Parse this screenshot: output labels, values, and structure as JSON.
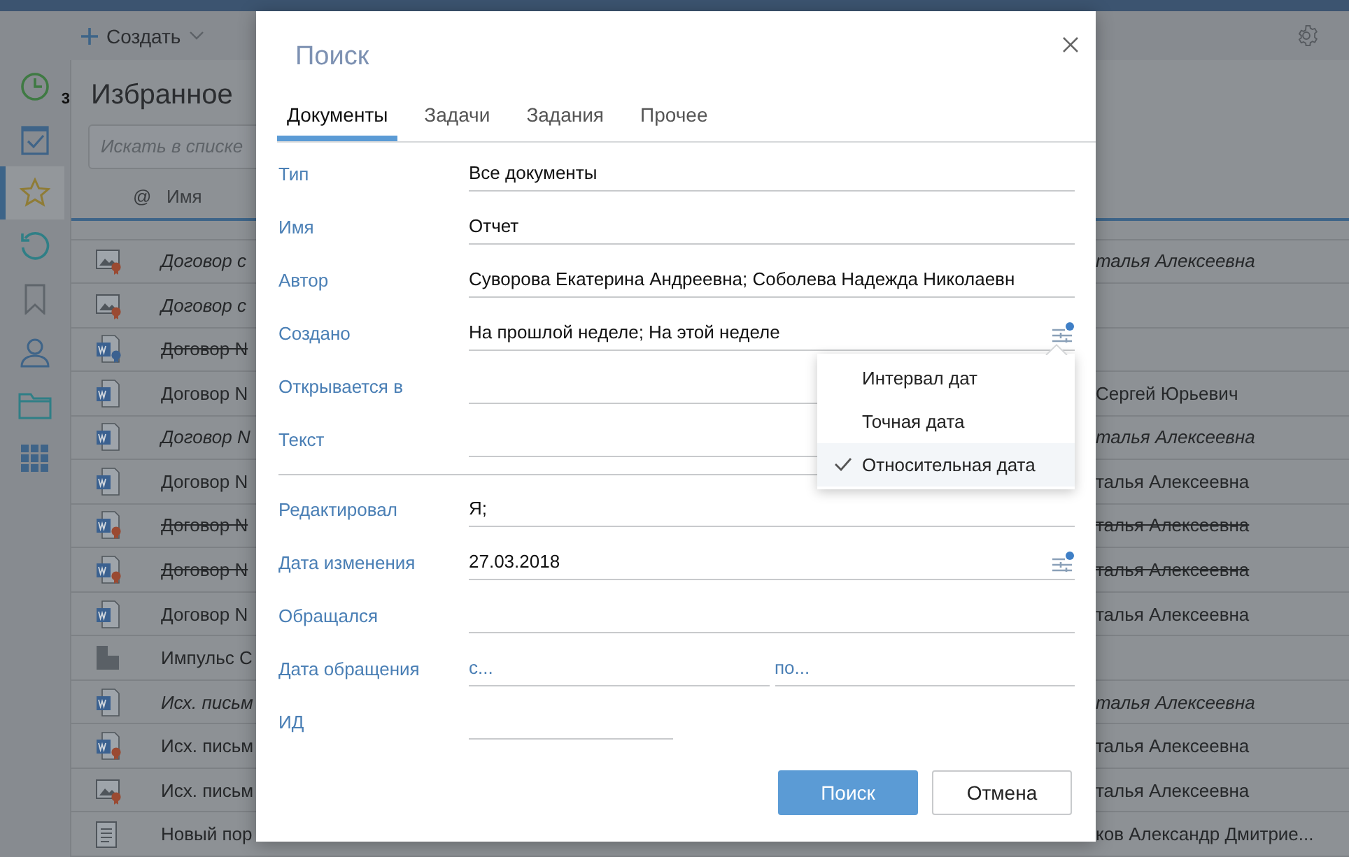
{
  "app": {
    "toolbar": {
      "create_label": "Создать"
    },
    "sidebar": {
      "items": [
        {
          "kind": "clock",
          "badge": "3",
          "selected": false
        },
        {
          "kind": "calendar",
          "selected": false
        },
        {
          "kind": "star",
          "selected": true
        },
        {
          "kind": "history",
          "selected": false
        },
        {
          "kind": "bookmark",
          "selected": false
        },
        {
          "kind": "person",
          "selected": false
        },
        {
          "kind": "folder",
          "selected": false
        },
        {
          "kind": "apps",
          "selected": false
        }
      ]
    },
    "list": {
      "title": "Избранное",
      "search": {
        "placeholder": "Искать в списке"
      },
      "columns": [
        "@",
        "Имя"
      ],
      "rows": [
        {
          "kind": "image",
          "name": "Договор с",
          "author": "талья Алексеевна",
          "emphasized": true,
          "deleted": false
        },
        {
          "kind": "image",
          "name": "Договор с",
          "emphasized": true,
          "deleted": false
        },
        {
          "kind": "signed",
          "name": "Договор N",
          "emphasized": false,
          "deleted": true
        },
        {
          "kind": "word",
          "name": "Договор N",
          "author": "Сергей Юрьевич",
          "emphasized": false,
          "deleted": false
        },
        {
          "kind": "word",
          "name": "Договор N",
          "author": "талья Алексеевна",
          "emphasized": true,
          "deleted": false
        },
        {
          "kind": "word",
          "name": "Договор N",
          "author": "талья Алексеевна",
          "emphasized": false,
          "deleted": false
        },
        {
          "kind": "sealed",
          "name": "Договор N",
          "author": "талья Алексеевна",
          "emphasized": false,
          "deleted": true
        },
        {
          "kind": "sealed",
          "name": "Договор N",
          "author": "талья Алексеевна",
          "emphasized": false,
          "deleted": true
        },
        {
          "kind": "word",
          "name": "Договор N",
          "author": "талья Алексеевна",
          "emphasized": false,
          "deleted": false
        },
        {
          "kind": "company",
          "name": "Импульс С",
          "emphasized": false,
          "deleted": false
        },
        {
          "kind": "word",
          "name": "Исх. письм",
          "author": "талья Алексеевна",
          "emphasized": true,
          "deleted": false
        },
        {
          "kind": "sealed",
          "name": "Исх. письм",
          "author": "талья Алексеевна",
          "emphasized": false,
          "deleted": false
        },
        {
          "kind": "image",
          "name": "Исх. письм",
          "author": "талья Алексеевна",
          "emphasized": false,
          "deleted": false
        },
        {
          "kind": "text",
          "name": "Новый пор",
          "author": "ков Александр Дмитрие...",
          "emphasized": false,
          "deleted": false
        }
      ]
    }
  },
  "dialog": {
    "title": "Поиск",
    "tabs": [
      {
        "label": "Документы",
        "selected": true
      },
      {
        "label": "Задачи",
        "selected": false
      },
      {
        "label": "Задания",
        "selected": false
      },
      {
        "label": "Прочее",
        "selected": false
      }
    ],
    "fields": [
      {
        "kind": "text",
        "label": "Тип",
        "value": "Все документы"
      },
      {
        "kind": "text",
        "label": "Имя",
        "value": "Отчет"
      },
      {
        "kind": "text",
        "label": "Автор",
        "value": "Суворова Екатерина Андреевна; Соболева Надежда Николаевн"
      },
      {
        "kind": "date",
        "label": "Создано",
        "value": "На прошлой неделе; На этой неделе"
      },
      {
        "kind": "text",
        "label": "Открывается в"
      },
      {
        "kind": "text",
        "label": "Текст"
      },
      {
        "kind": "divider"
      },
      {
        "kind": "text",
        "label": "Редактировал",
        "value": "Я;"
      },
      {
        "kind": "date",
        "label": "Дата изменения",
        "value": "27.03.2018"
      },
      {
        "kind": "text",
        "label": "Обращался"
      },
      {
        "kind": "range",
        "label": "Дата обращения",
        "from_placeholder": "с...",
        "to_placeholder": "по..."
      },
      {
        "kind": "short",
        "label": "ИД"
      }
    ],
    "menu": {
      "items": [
        {
          "label": "Интервал дат",
          "selected": false
        },
        {
          "label": "Точная дата",
          "selected": false
        },
        {
          "label": "Относительная дата",
          "selected": true
        }
      ]
    },
    "buttons": [
      {
        "label": "Поиск",
        "kind": "primary"
      },
      {
        "label": "Отмена",
        "kind": "secondary"
      }
    ]
  }
}
